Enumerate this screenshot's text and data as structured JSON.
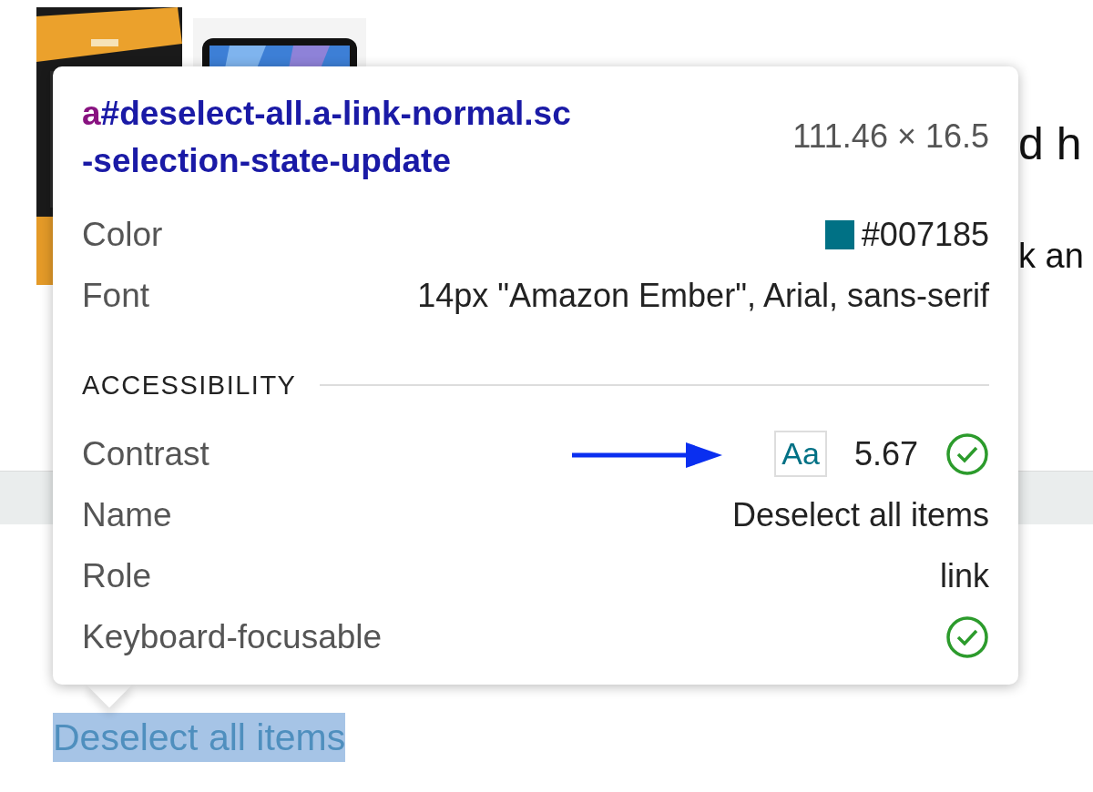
{
  "page": {
    "heading_fragment": "d h",
    "text_fragment": "k an",
    "link": {
      "label": "Deselect all items",
      "selected": true
    }
  },
  "tooltip": {
    "selector": {
      "tag": "a",
      "lines": [
        "#deselect-all.a-link-normal.sc",
        "-selection-state-update"
      ]
    },
    "size": "111.46 × 16.5",
    "rows": [
      {
        "kind": "color",
        "label": "Color",
        "value": "#007185",
        "color": "#007185"
      },
      {
        "kind": "text",
        "label": "Font",
        "value": "14px \"Amazon Ember\", Arial, sans-serif"
      }
    ],
    "section": "ACCESSIBILITY",
    "accessibility": [
      {
        "kind": "contrast",
        "label": "Contrast",
        "sample": "Aa",
        "value": "5.67",
        "passed": true
      },
      {
        "kind": "text",
        "label": "Name",
        "value": "Deselect all items"
      },
      {
        "kind": "text",
        "label": "Role",
        "value": "link"
      },
      {
        "kind": "check",
        "label": "Keyboard-focusable",
        "passed": true
      }
    ]
  }
}
